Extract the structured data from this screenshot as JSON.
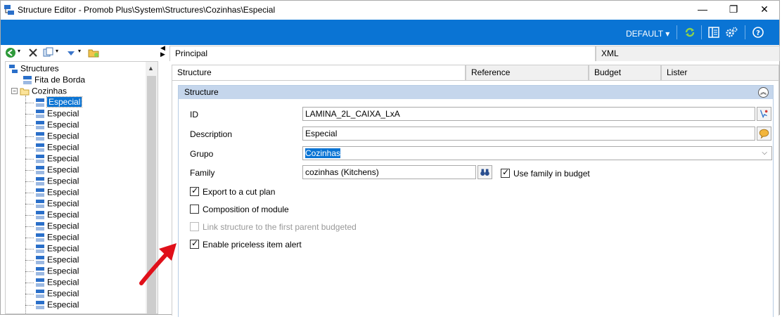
{
  "window": {
    "title": "Structure Editor - Promob Plus\\System\\Structures\\Cozinhas\\Especial",
    "controls": {
      "minimize": "—",
      "maximize": "❐",
      "close": "✕"
    }
  },
  "toolbar": {
    "profile_label": "DEFAULT ▾",
    "icons": [
      "refresh-icon",
      "layout-icon",
      "settings-icon",
      "help-icon"
    ]
  },
  "left_toolbar": {
    "icons": [
      "back-icon",
      "delete-icon",
      "copy-icon",
      "move-icon",
      "folder-icon"
    ]
  },
  "tree": {
    "root": "Structures",
    "items": [
      {
        "label": "Fita de Borda"
      },
      {
        "label": "Cozinhas"
      }
    ],
    "children": [
      "Especial",
      "Especial",
      "Especial",
      "Especial",
      "Especial",
      "Especial",
      "Especial",
      "Especial",
      "Especial",
      "Especial",
      "Especial",
      "Especial",
      "Especial",
      "Especial",
      "Especial",
      "Especial",
      "Especial",
      "Especial",
      "Especial"
    ],
    "selected_index": 0
  },
  "main_tabs": [
    {
      "label": "Principal",
      "active": true
    },
    {
      "label": "XML",
      "active": false
    }
  ],
  "sub_tabs": [
    {
      "label": "Structure",
      "active": true
    },
    {
      "label": "Reference",
      "active": false
    },
    {
      "label": "Budget",
      "active": false
    },
    {
      "label": "Lister",
      "active": false
    }
  ],
  "structure_group": {
    "title": "Structure",
    "id_label": "ID",
    "id_value": "LAMINA_2L_CAIXA_LxA",
    "description_label": "Description",
    "description_value": "Especial",
    "grupo_label": "Grupo",
    "grupo_value": "Cozinhas",
    "family_label": "Family",
    "family_value": "cozinhas (Kitchens)",
    "use_family_label": "Use family in budget",
    "use_family_checked": true,
    "checkboxes": [
      {
        "label": "Export to a cut plan",
        "checked": true,
        "disabled": false
      },
      {
        "label": "Composition of module",
        "checked": false,
        "disabled": false
      },
      {
        "label": "Link structure to the first parent budgeted",
        "checked": false,
        "disabled": true
      },
      {
        "label": "Enable priceless item alert",
        "checked": true,
        "disabled": false
      }
    ]
  },
  "colors": {
    "accent": "#0a74d4",
    "group_header": "#c5d6ec",
    "annotation_arrow": "#e0101a"
  }
}
